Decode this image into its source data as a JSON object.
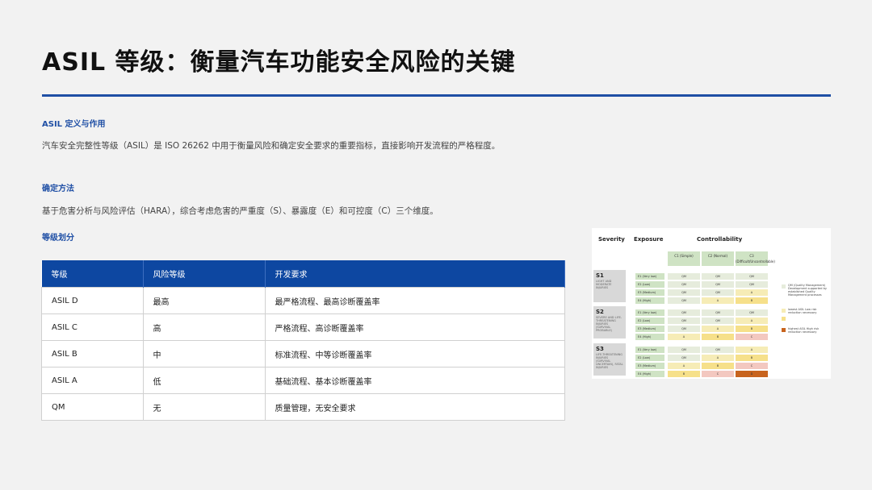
{
  "title": "ASIL 等级：衡量汽车功能安全风险的关键",
  "sections": {
    "definition": {
      "heading": "ASIL 定义与作用",
      "text": "汽车安全完整性等级（ASIL）是 ISO 26262 中用于衡量风险和确定安全要求的重要指标，直接影响开发流程的严格程度。"
    },
    "method": {
      "heading": "确定方法",
      "text": "基于危害分析与风险评估（HARA），综合考虑危害的严重度（S）、暴露度（E）和可控度（C）三个维度。"
    },
    "grading": {
      "heading": "等级划分"
    }
  },
  "table": {
    "headers": [
      "等级",
      "风险等级",
      "开发要求"
    ],
    "rows": [
      [
        "ASIL D",
        "最高",
        "最严格流程、最高诊断覆盖率"
      ],
      [
        "ASIL C",
        "高",
        "严格流程、高诊断覆盖率"
      ],
      [
        "ASIL B",
        "中",
        "标准流程、中等诊断覆盖率"
      ],
      [
        "ASIL A",
        "低",
        "基础流程、基本诊断覆盖率"
      ],
      [
        "QM",
        "无",
        "质量管理，无安全要求"
      ]
    ]
  },
  "matrix": {
    "headers": {
      "severity": "Severity",
      "exposure": "Exposure",
      "controllability": "Controllability"
    },
    "c_levels": [
      "C1\n(Simple)",
      "C2\n(Normal)",
      "C3\n(Difficult/Uncontrollable)"
    ],
    "s_levels": [
      {
        "label": "S1",
        "desc": "LIGHT AND MODERATE INJURIES"
      },
      {
        "label": "S2",
        "desc": "SEVERE AND LIFE-THREATENING INJURIES (SURVIVAL PROBABLE)"
      },
      {
        "label": "S3",
        "desc": "LIFE-THREATENING INJURIES (SURVIVAL UNCERTAIN), FATAL INJURIES"
      }
    ],
    "e_levels": [
      "E1 (Very low)",
      "E2 (Low)",
      "E3 (Medium)",
      "E4 (High)"
    ],
    "grid": [
      [
        [
          "QM",
          "QM",
          "QM"
        ],
        [
          "QM",
          "QM",
          "QM"
        ],
        [
          "QM",
          "QM",
          "A"
        ],
        [
          "QM",
          "A",
          "B"
        ]
      ],
      [
        [
          "QM",
          "QM",
          "QM"
        ],
        [
          "QM",
          "QM",
          "A"
        ],
        [
          "QM",
          "A",
          "B"
        ],
        [
          "A",
          "B",
          "C"
        ]
      ],
      [
        [
          "QM",
          "QM",
          "A"
        ],
        [
          "QM",
          "A",
          "B"
        ],
        [
          "A",
          "B",
          "C"
        ],
        [
          "B",
          "C",
          "D"
        ]
      ]
    ],
    "colors": {
      "QM": "#e6ecdc",
      "A": "#f6ecb6",
      "B": "#f6e08a",
      "C": "#f3c8c0",
      "D": "#c8641e"
    },
    "legend": {
      "qm": "QM (Quality Management) Development supported by established Quality Management processes",
      "lowest": "lowest ASIL Low risk reduction necessary",
      "highest": "highest ASIL High risk reduction necessary"
    }
  }
}
